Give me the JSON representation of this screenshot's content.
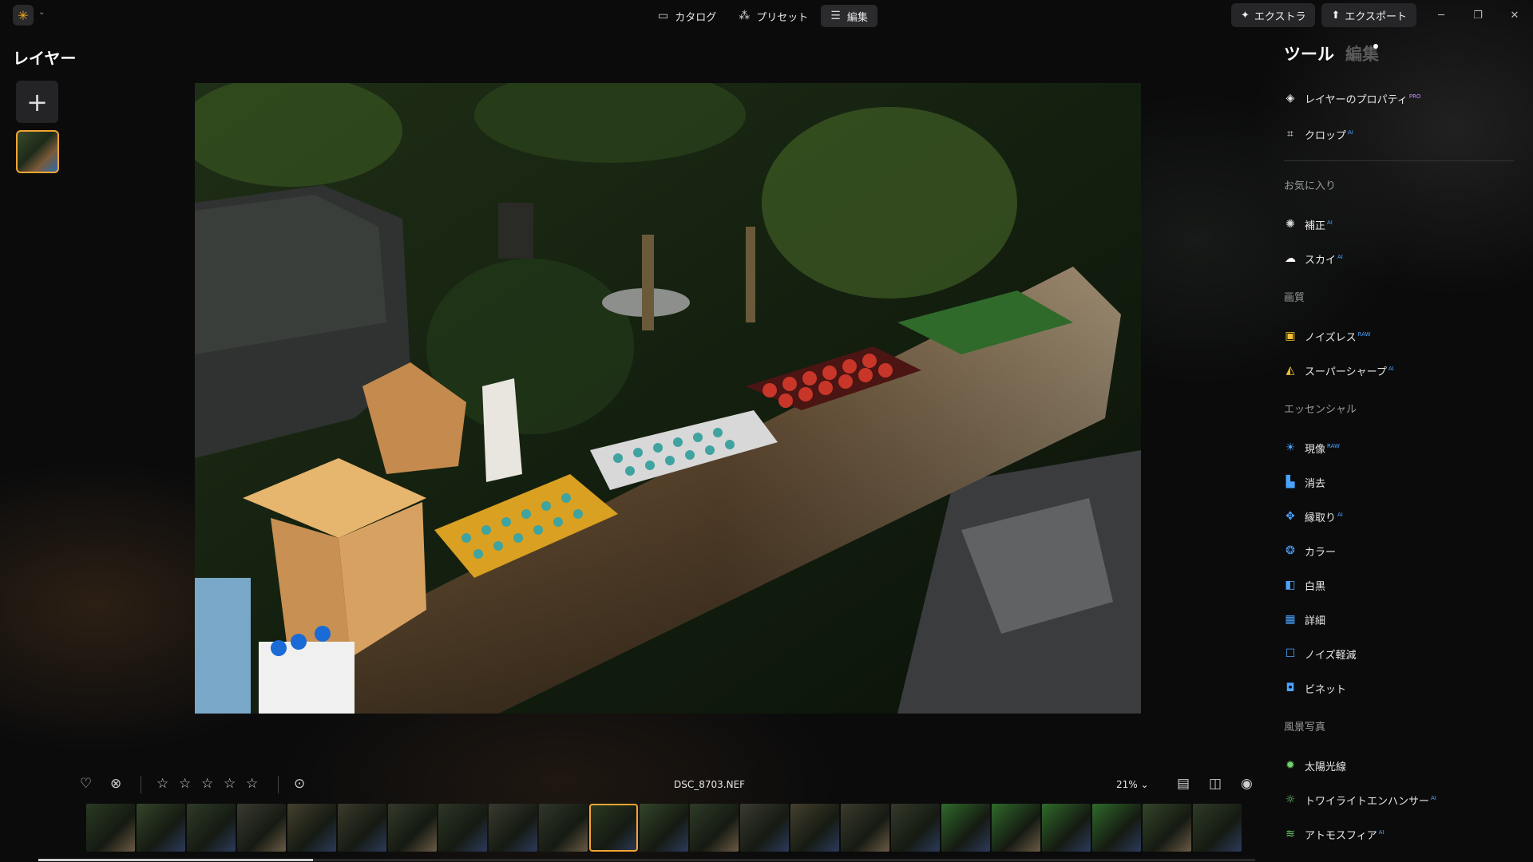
{
  "topbar": {
    "tabs": [
      {
        "label": "カタログ",
        "icon": "folder-icon"
      },
      {
        "label": "プリセット",
        "icon": "sparkle-wand-icon"
      },
      {
        "label": "編集",
        "icon": "sliders-icon",
        "active": true
      }
    ],
    "extras_label": "エクストラ",
    "export_label": "エクスポート"
  },
  "left_panel": {
    "title": "レイヤー",
    "add_label": "+"
  },
  "bottom_bar": {
    "filename": "DSC_8703.NEF",
    "zoom": "21%",
    "rating_stars": 0
  },
  "filmstrip": {
    "selected_index": 10,
    "frame_count": 23
  },
  "right_panel": {
    "tabs": [
      "ツール",
      "編集"
    ],
    "top_tools": [
      {
        "label": "レイヤーのプロパティ",
        "badge": "PRO",
        "icon": "layers-icon"
      },
      {
        "label": "クロップ",
        "badge": "AI",
        "icon": "crop-icon"
      }
    ],
    "sections": [
      {
        "title": "お気に入り",
        "tools": [
          {
            "label": "補正",
            "badge": "AI",
            "icon": "spark-icon",
            "color": "#d8d8d8"
          },
          {
            "label": "スカイ",
            "badge": "AI",
            "icon": "cloud-icon",
            "color": "#ffffff"
          }
        ]
      },
      {
        "title": "画質",
        "tools": [
          {
            "label": "ノイズレス",
            "badge": "RAW",
            "icon": "noiseless-icon",
            "color": "#f3c130"
          },
          {
            "label": "スーパーシャープ",
            "badge": "AI",
            "icon": "supersharp-icon",
            "color": "#f3c130"
          }
        ]
      },
      {
        "title": "エッセンシャル",
        "tools": [
          {
            "label": "現像",
            "badge": "RAW",
            "icon": "sun-develop-icon",
            "color": "#4aa3ff"
          },
          {
            "label": "消去",
            "badge": "",
            "icon": "eraser-icon",
            "color": "#4aa3ff"
          },
          {
            "label": "縁取り",
            "badge": "AI",
            "icon": "dots-structure-icon",
            "color": "#4aa3ff"
          },
          {
            "label": "カラー",
            "badge": "",
            "icon": "color-wheel-icon",
            "color": "#4aa3ff"
          },
          {
            "label": "白黒",
            "badge": "",
            "icon": "half-square-icon",
            "color": "#4aa3ff"
          },
          {
            "label": "詳細",
            "badge": "",
            "icon": "grid-square-icon",
            "color": "#4aa3ff"
          },
          {
            "label": "ノイズ軽減",
            "badge": "",
            "icon": "square-outline-icon",
            "color": "#4aa3ff"
          },
          {
            "label": "ビネット",
            "badge": "",
            "icon": "vignette-icon",
            "color": "#4aa3ff"
          }
        ]
      },
      {
        "title": "風景写真",
        "tools": [
          {
            "label": "太陽光線",
            "badge": "",
            "icon": "sunrays-icon",
            "color": "#6fd36b"
          },
          {
            "label": "トワイライトエンハンサー",
            "badge": "AI",
            "icon": "twilight-icon",
            "color": "#6fd36b"
          },
          {
            "label": "アトモスフィア",
            "badge": "AI",
            "icon": "atmosphere-icon",
            "color": "#6fd36b"
          }
        ]
      }
    ]
  }
}
